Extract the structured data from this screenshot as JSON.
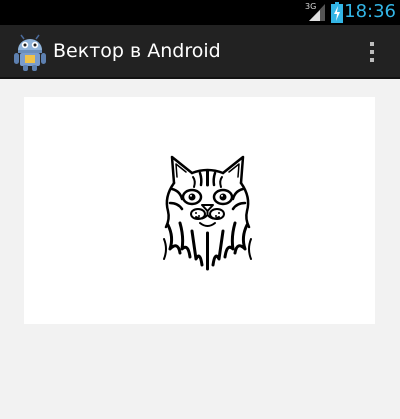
{
  "status_bar": {
    "network_label": "3G",
    "time": "18:36",
    "icons": [
      "signal-icon",
      "battery-charging-icon"
    ],
    "time_color": "#33b5e5"
  },
  "action_bar": {
    "title": "Вектор в Android",
    "app_icon": "android-robot-icon",
    "overflow_icon": "overflow-menu-icon",
    "background": "#222222"
  },
  "content": {
    "image": "cat-head-vector",
    "card_background": "#ffffff",
    "page_background": "#f2f2f2"
  }
}
